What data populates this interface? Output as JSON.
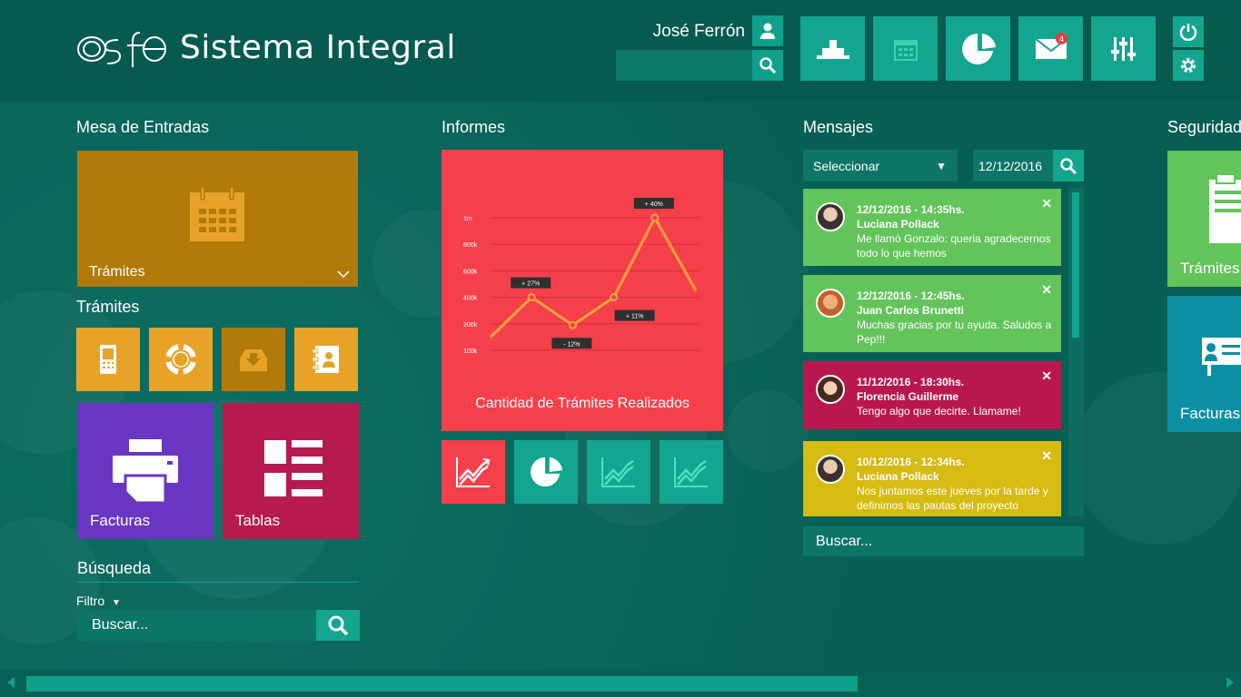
{
  "app": {
    "brand": "osfe",
    "title": "Sistema Integral"
  },
  "header": {
    "user_name": "José Ferrón",
    "search_placeholder": "",
    "mail_badge": "4",
    "tiles": [
      "bell-icon",
      "calendar-icon",
      "pie-chart-icon",
      "mail-icon",
      "sliders-icon"
    ]
  },
  "mesa": {
    "title": "Mesa de Entradas",
    "main_tile_label": "Trámites",
    "tramites_title": "Trámites",
    "facturas_label": "Facturas",
    "tablas_label": "Tablas"
  },
  "busqueda": {
    "title": "Búsqueda",
    "filter_label": "Filtro",
    "placeholder": "Buscar..."
  },
  "informes": {
    "title": "Informes",
    "chart_caption": "Cantidad de Trámites Realizados"
  },
  "chart_data": {
    "type": "line",
    "title": "Cantidad de Trámites Realizados",
    "y_ticks": [
      "100k",
      "200k",
      "400k",
      "600k",
      "800k",
      "1m"
    ],
    "values": [
      100,
      400,
      190,
      400,
      1000,
      450
    ],
    "annotations": [
      {
        "point": 1,
        "label": "+ 27%"
      },
      {
        "point": 2,
        "label": "- 12%"
      },
      {
        "point": 3,
        "label": "+ 11%"
      },
      {
        "point": 4,
        "label": "+ 40%"
      }
    ],
    "ylim": [
      0,
      1000
    ],
    "colors": {
      "line": "#f7a33a",
      "background": "#f5404c"
    }
  },
  "mensajes": {
    "title": "Mensajes",
    "select_label": "Seleccionar",
    "date_value": "12/12/2016",
    "search_placeholder": "Buscar...",
    "items": [
      {
        "date": "12/12/2016 - 14:35hs.",
        "name": "Luciana Pollack",
        "text": "Me llamó Gonzalo: queria agradecernos todo lo que hemos",
        "color": "#62c45a"
      },
      {
        "date": "12/12/2016 - 12:45hs.",
        "name": "Juan Carlos Brunetti",
        "text": "Muchas gracias por tu ayuda. Saludos a Pep!!!",
        "color": "#62c45a"
      },
      {
        "date": "11/12/2016 - 18:30hs.",
        "name": "Florencia Guillerme",
        "text": "Tengo algo que decirte. Llamame!",
        "color": "#b9184e"
      },
      {
        "date": "10/12/2016 - 12:34hs.",
        "name": "Luciana Pollack",
        "text": "Nos juntamos este jueves por la tarde y definimos las pautas del proyecto",
        "color": "#d5bb12"
      }
    ]
  },
  "seguridad": {
    "title": "Seguridad",
    "tramites_label": "Trámites",
    "facturas_label": "Facturas"
  }
}
